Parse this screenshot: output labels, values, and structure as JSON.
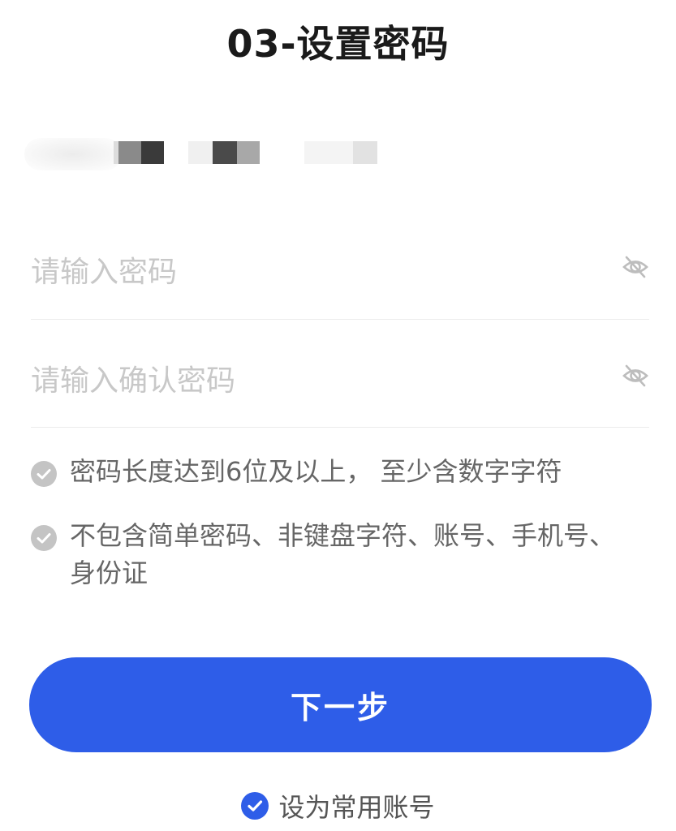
{
  "page": {
    "title": "03-设置密码"
  },
  "form": {
    "password_placeholder": "请输入密码",
    "confirm_placeholder": "请输入确认密码"
  },
  "rules": [
    {
      "text": "密码长度达到6位及以上， 至少含数字字符"
    },
    {
      "text": "不包含简单密码、非键盘字符、账号、手机号、身份证"
    }
  ],
  "actions": {
    "next_label": "下一步",
    "remember_label": "设为常用账号"
  },
  "colors": {
    "accent": "#2e5de8",
    "rule_check": "#c4c4c4",
    "placeholder": "#c8c8c8"
  },
  "icons": {
    "password_visibility": "eye-off-icon",
    "confirm_visibility": "eye-off-icon",
    "rule_check": "check-circle-icon",
    "remember_check": "check-circle-filled-icon"
  }
}
